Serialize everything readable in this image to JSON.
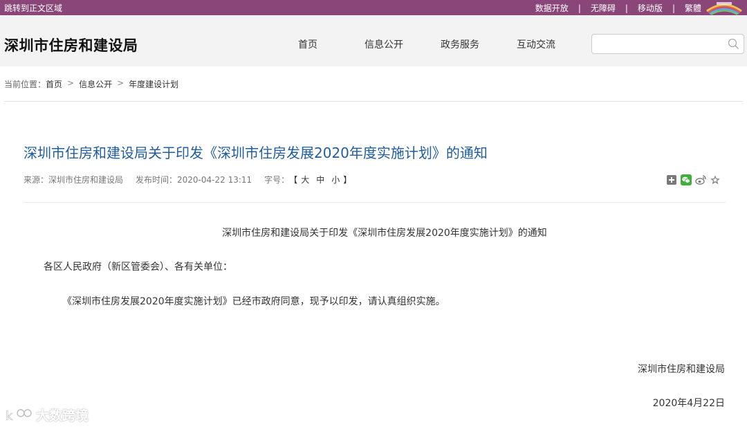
{
  "topbar": {
    "skip_link": "跳转到正文区域",
    "links": [
      "数据开放",
      "无障碍",
      "移动版",
      "繁體"
    ],
    "separator": "|"
  },
  "header": {
    "site_title": "深圳市住房和建设局",
    "nav": [
      "首页",
      "信息公开",
      "政务服务",
      "互动交流"
    ],
    "search_placeholder": ""
  },
  "breadcrumb": {
    "prefix": "当前位置：",
    "items": [
      "首页",
      "信息公开",
      "年度建设计划"
    ],
    "arrow": ">"
  },
  "article": {
    "title": "深圳市住房和建设局关于印发《深圳市住房发展2020年度实施计划》的通知",
    "source_label": "来源：深圳市住房和建设局",
    "publish_label": "发布时间：2020-04-22 13:11",
    "font_label": "字号：",
    "font_open": "【",
    "font_sizes": [
      "大",
      "中",
      "小"
    ],
    "font_close": "】",
    "body_title": "深圳市住房和建设局关于印发《深圳市住房发展2020年度实施计划》的通知",
    "salutation": "各区人民政府（新区管委会）、各有关单位：",
    "paragraph": "《深圳市住房发展2020年度实施计划》已经市政府同意，现予以印发，请认真组织实施。",
    "signature": "深圳市住房和建设局",
    "date": "2020年4月22日"
  },
  "share_icons": [
    "plus-share-icon",
    "wechat-icon",
    "weibo-icon",
    "star-icon"
  ],
  "watermark": {
    "text": "大数跨境"
  },
  "colors": {
    "topbar": "#8a4678",
    "title": "#1f5ca0",
    "header_bg": "#f3f3f3"
  }
}
